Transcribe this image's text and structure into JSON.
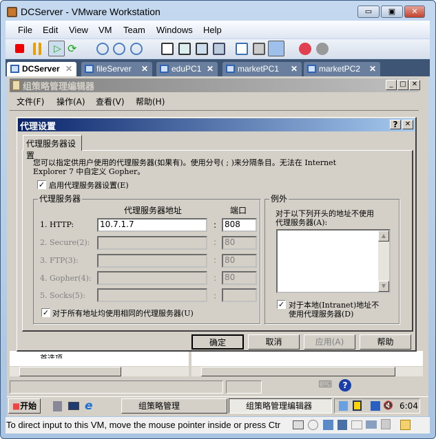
{
  "window": {
    "title": "DCServer - VMware Workstation",
    "minimize": "▭",
    "restore": "▣",
    "close": "✕"
  },
  "menu": [
    "File",
    "Edit",
    "View",
    "VM",
    "Team",
    "Windows",
    "Help"
  ],
  "tabs": [
    {
      "label": "DCServer",
      "active": true
    },
    {
      "label": "fileServer"
    },
    {
      "label": "eduPC1"
    },
    {
      "label": "marketPC1"
    },
    {
      "label": "marketPC2"
    }
  ],
  "gpe": {
    "title": "组策略管理编辑器",
    "menu": [
      "文件(F)",
      "操作(A)",
      "查看(V)",
      "帮助(H)"
    ],
    "tree_item": "首选项"
  },
  "dialog": {
    "title": "代理设置",
    "help": "?",
    "close": "✕",
    "tab": "代理服务器设置",
    "description_line1": "您可以指定供用户使用的代理服务器(如果有)。使用分号( ; )来分隔条目。无法在 Internet",
    "description_line2": "Explorer 7 中自定义 Gopher。",
    "enable_label": "启用代理服务器设置(E)",
    "enable_checked": true,
    "proxy_group": "代理服务器",
    "address_header": "代理服务器地址",
    "port_header": "端口",
    "rows": [
      {
        "label": "1. HTTP:",
        "address": "10.7.1.7",
        "port": "808",
        "enabled": true
      },
      {
        "label": "2. Secure(2):",
        "address": "",
        "port": "80",
        "enabled": false
      },
      {
        "label": "3. FTP(3):",
        "address": "",
        "port": "80",
        "enabled": false
      },
      {
        "label": "4. Gopher(4):",
        "address": "",
        "port": "80",
        "enabled": false
      },
      {
        "label": "5. Socks(5):",
        "address": "",
        "port": "",
        "enabled": false
      }
    ],
    "colon": ":",
    "same_proxy_label": "对于所有地址均使用相同的代理服务器(U)",
    "same_proxy_checked": true,
    "exceptions_group": "例外",
    "exceptions_label_line1": "对于以下列开头的地址不使用",
    "exceptions_label_line2": "代理服务器(A):",
    "exceptions_value": "",
    "bypass_local_line1": "对于本地(Intranet)地址不",
    "bypass_local_line2": "使用代理服务器(D)",
    "bypass_local_checked": true,
    "buttons": {
      "ok": "确定",
      "cancel": "取消",
      "apply": "应用(A)",
      "help": "帮助"
    }
  },
  "taskbar": {
    "start": "开始",
    "items": [
      "组策略管理",
      "组策略管理编辑器"
    ],
    "clock": "6:04"
  },
  "status": {
    "message": "To direct input to this VM, move the mouse pointer inside or press Ctr"
  }
}
